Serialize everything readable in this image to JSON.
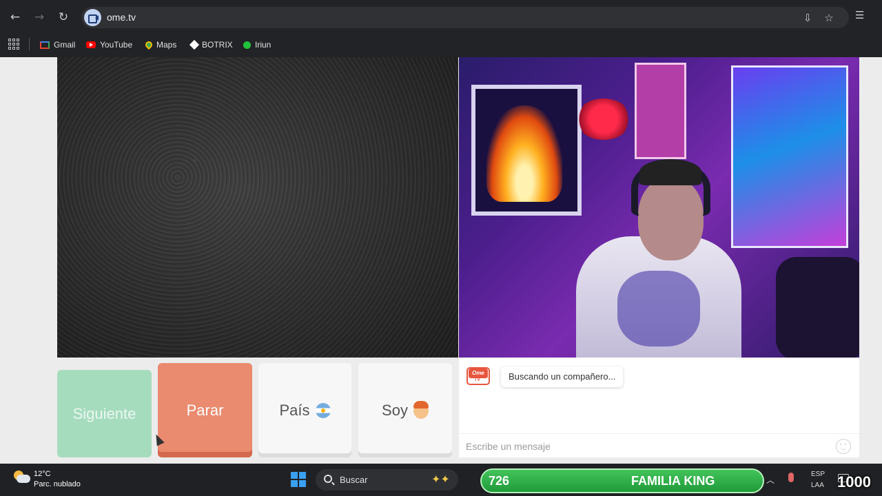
{
  "browser": {
    "url": "ome.tv",
    "bookmarks": [
      {
        "label": "Gmail",
        "icon": "gmail-icon"
      },
      {
        "label": "YouTube",
        "icon": "youtube-icon"
      },
      {
        "label": "Maps",
        "icon": "maps-icon"
      },
      {
        "label": "BOTRIX",
        "icon": "botrix-icon"
      },
      {
        "label": "Iriun",
        "icon": "iriun-icon"
      }
    ]
  },
  "controls": {
    "next_label": "Siguiente",
    "stop_label": "Parar",
    "country_label": "País",
    "gender_label": "Soy"
  },
  "chat": {
    "status_message": "Buscando un compañero...",
    "input_placeholder": "Escribe un mensaje"
  },
  "taskbar": {
    "temperature": "12°C",
    "weather": "Parc. nublado",
    "search_label": "Buscar",
    "language_top": "ESP",
    "language_bottom": "LAA"
  },
  "overlay": {
    "count": "726",
    "name": "FAMILIA KING",
    "score": "1000"
  },
  "colors": {
    "next_button": "#a6dcbe",
    "stop_button": "#ea8a6f",
    "brand": "#e8553d",
    "overlay_green": "#2faa45"
  }
}
